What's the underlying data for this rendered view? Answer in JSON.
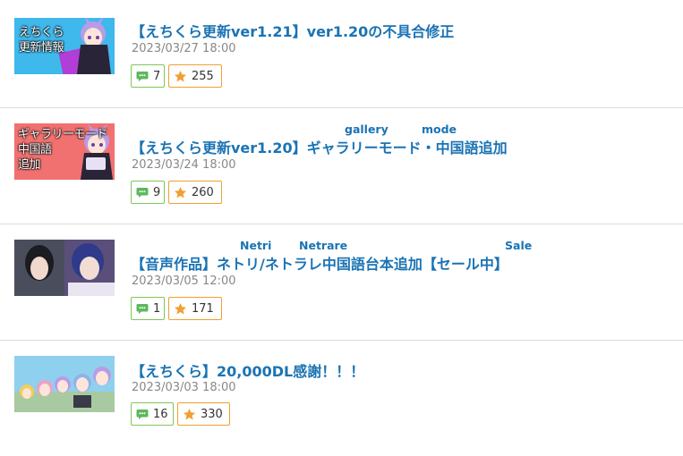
{
  "posts": [
    {
      "title": "【えちくら更新ver1.21】ver1.20の不具合修正",
      "date": "2023/03/27 18:00",
      "comments": "7",
      "favorites": "255",
      "thumb_text": "えちくら\n更新情報",
      "thumb_bg": "#3fb8ec"
    },
    {
      "title": "【えちくら更新ver1.20】ギャラリーモード・中国語追加",
      "date": "2023/03/24 18:00",
      "comments": "9",
      "favorites": "260",
      "thumb_text": "ギャラリーモード\n中国語\n追加",
      "thumb_bg": "#f0716f",
      "ruby": [
        "gallery",
        "mode"
      ]
    },
    {
      "title": "【音声作品】ネトリ/ネトラレ中国語台本追加【セール中】",
      "date": "2023/03/05 12:00",
      "comments": "1",
      "favorites": "171",
      "ruby": [
        "Netri",
        "Netrare",
        "Sale"
      ]
    },
    {
      "title": "【えちくら】20,000DL感謝！！！",
      "date": "2023/03/03 18:00",
      "comments": "16",
      "favorites": "330"
    }
  ],
  "colors": {
    "link": "#1a73b4",
    "comment_badge": "#7dc858",
    "favorite_badge": "#f0a030"
  },
  "icons": {
    "comment": "speech-bubble-icon",
    "favorite": "star-icon"
  }
}
